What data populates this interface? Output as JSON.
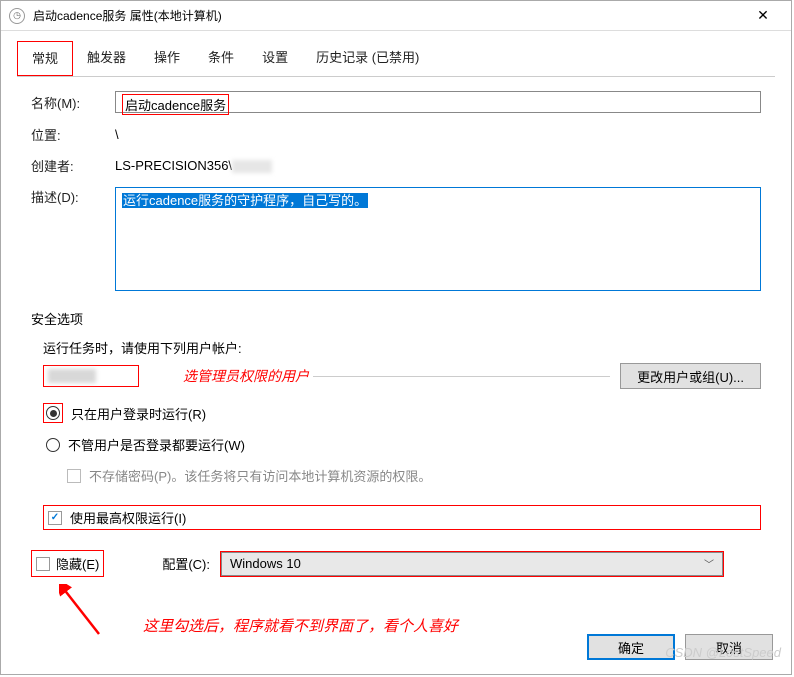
{
  "window": {
    "title": "启动cadence服务 属性(本地计算机)",
    "close": "✕"
  },
  "tabs": {
    "items": [
      "常规",
      "触发器",
      "操作",
      "条件",
      "设置",
      "历史记录 (已禁用)"
    ],
    "active_index": 0
  },
  "fields": {
    "name_label": "名称(M):",
    "name_value": "启动cadence服务",
    "location_label": "位置:",
    "location_value": "\\",
    "creator_label": "创建者:",
    "creator_value": "LS-PRECISION356\\",
    "desc_label": "描述(D):",
    "desc_value": "运行cadence服务的守护程序，自己写的。"
  },
  "security": {
    "title": "安全选项",
    "run_as_label": "运行任务时，请使用下列用户帐户:",
    "change_user_btn": "更改用户或组(U)...",
    "radio1": "只在用户登录时运行(R)",
    "radio2": "不管用户是否登录都要运行(W)",
    "no_store_pwd": "不存储密码(P)。该任务将只有访问本地计算机资源的权限。",
    "highest_priv": "使用最高权限运行(I)"
  },
  "bottom": {
    "hidden_label": "隐藏(E)",
    "config_label": "配置(C):",
    "config_value": "Windows 10"
  },
  "buttons": {
    "ok": "确定",
    "cancel": "取消"
  },
  "annotations": {
    "user_note": "选管理员权限的用户",
    "hidden_note": "这里勾选后，程序就看不到界面了，看个人喜好"
  },
  "watermark": "CSDN @LostSpeed"
}
